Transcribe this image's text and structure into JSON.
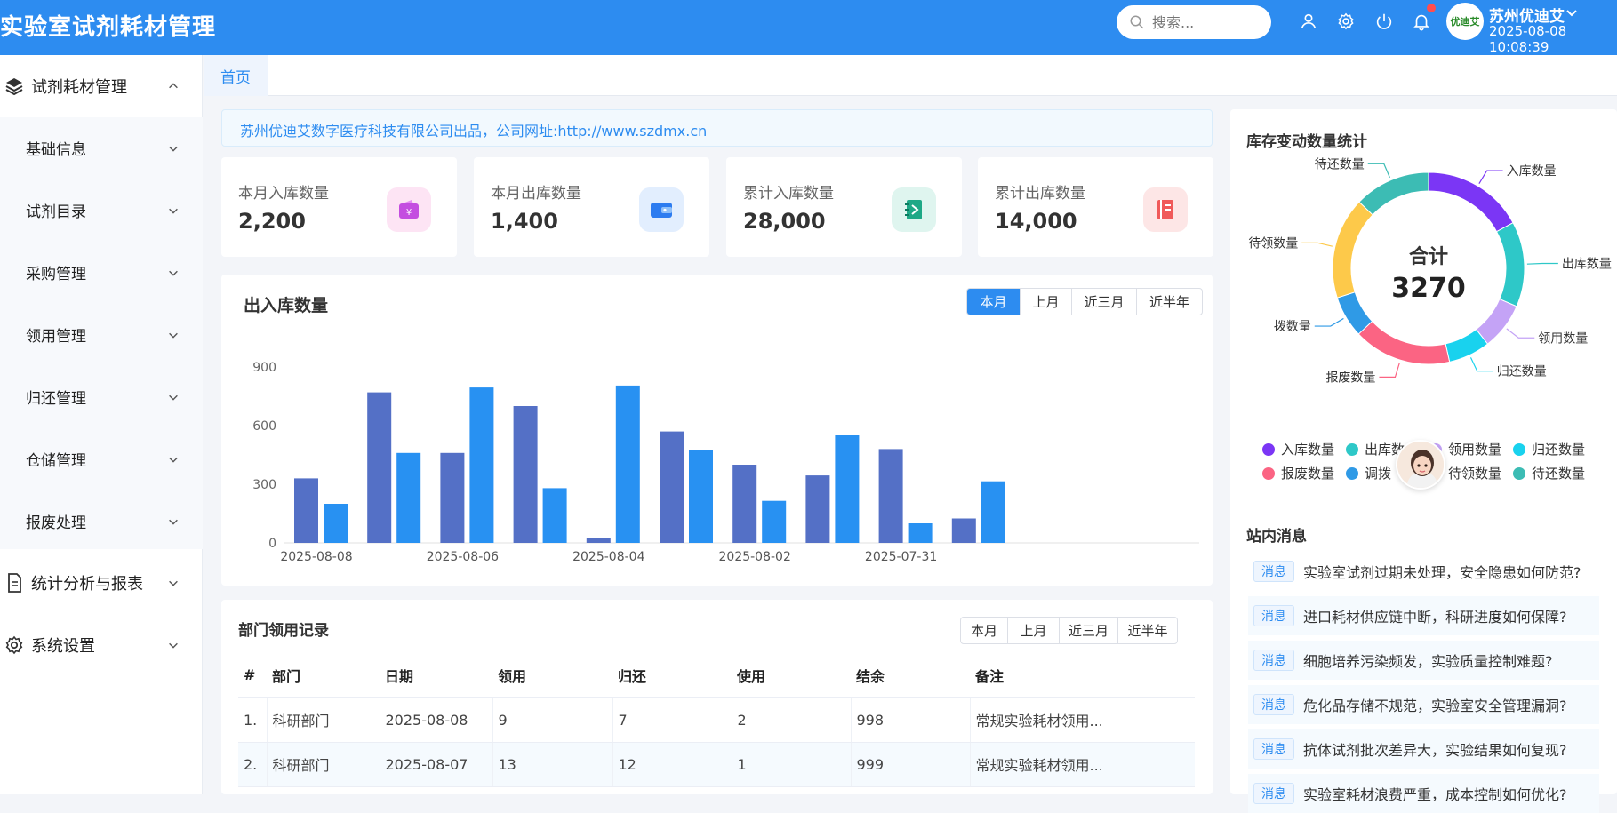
{
  "header": {
    "app_title": "实验室试剂耗材管理",
    "search_placeholder": "搜索...",
    "user_name": "苏州优迪艾",
    "datetime": "2025-08-08 10:08:39",
    "avatar_text": "优迪艾",
    "accent": "#2d8cf0"
  },
  "sidebar": {
    "groups": [
      {
        "label": "试剂耗材管理",
        "icon": "layers-icon",
        "expanded": true,
        "children": [
          "基础信息",
          "试剂目录",
          "采购管理",
          "领用管理",
          "归还管理",
          "仓储管理",
          "报废处理"
        ]
      },
      {
        "label": "统计分析与报表",
        "icon": "document-icon",
        "expanded": false
      },
      {
        "label": "系统设置",
        "icon": "settings-icon",
        "expanded": false
      }
    ]
  },
  "tabs": [
    "首页"
  ],
  "notice": "苏州优迪艾数字医疗科技有限公司出品，公司网址:http://www.szdmx.cn",
  "stats": [
    {
      "label": "本月入库数量",
      "value": "2,200",
      "icon": "wallet-icon",
      "bg": "#fde4f4",
      "color": "#c44de0"
    },
    {
      "label": "本月出库数量",
      "value": "1,400",
      "icon": "card-icon",
      "bg": "#e2eefe",
      "color": "#2d7cf0"
    },
    {
      "label": "累计入库数量",
      "value": "28,000",
      "icon": "notebook-icon",
      "bg": "#dff5ef",
      "color": "#1ea886"
    },
    {
      "label": "累计出库数量",
      "value": "14,000",
      "icon": "book-icon",
      "bg": "#fde6e6",
      "color": "#f05a5a"
    }
  ],
  "range_options": [
    "本月",
    "上月",
    "近三月",
    "近半年"
  ],
  "inout": {
    "title": "出入库数量",
    "active_range": "本月"
  },
  "chart_data": {
    "type": "bar",
    "x_tick_labels": [
      "2025-08-08",
      "2025-08-06",
      "2025-08-04",
      "2025-08-02",
      "2025-07-31"
    ],
    "ylim": [
      0,
      900
    ],
    "yticks": [
      0,
      300,
      600,
      900
    ],
    "grid": false,
    "series": [
      {
        "color": "#5470c6",
        "values": [
          330,
          770,
          460,
          700,
          25,
          570,
          400,
          345,
          480,
          125
        ]
      },
      {
        "color": "#2891f2",
        "values": [
          200,
          460,
          795,
          280,
          805,
          475,
          215,
          550,
          100,
          315
        ]
      }
    ]
  },
  "dept_table": {
    "title": "部门领用记录",
    "active_range": null,
    "columns": [
      "#",
      "部门",
      "日期",
      "领用",
      "归还",
      "使用",
      "结余",
      "备注"
    ],
    "rows": [
      [
        "1.",
        "科研部门",
        "2025-08-08",
        "9",
        "7",
        "2",
        "998",
        "常规实验耗材领用..."
      ],
      [
        "2.",
        "科研部门",
        "2025-08-07",
        "13",
        "12",
        "1",
        "999",
        "常规实验耗材领用..."
      ]
    ]
  },
  "donut": {
    "title": "库存变动数量统计",
    "center_label": "合计",
    "center_value": "3270",
    "segments": [
      {
        "name": "入库数量",
        "label": "入库数量",
        "value": 560,
        "color": "#7b36f5"
      },
      {
        "name": "出库数量",
        "label": "出库数量",
        "value": 470,
        "color": "#2ec8c8"
      },
      {
        "name": "领用数量",
        "label": "领用数量",
        "value": 260,
        "color": "#c4a3f6"
      },
      {
        "name": "归还数量",
        "label": "归还数量",
        "value": 230,
        "color": "#19d2ee"
      },
      {
        "name": "报废数量",
        "label": "报废数量",
        "value": 540,
        "color": "#fb6483"
      },
      {
        "name": "调拨数量",
        "label": "拨数量",
        "value": 230,
        "color": "#2f9ae6"
      },
      {
        "name": "待领数量",
        "label": "待领数量",
        "value": 560,
        "color": "#fdc94a"
      },
      {
        "name": "待还数量",
        "label": "待还数量",
        "value": 420,
        "color": "#3cbcb4"
      }
    ],
    "legend_visible": [
      "入库数量",
      "出库数",
      "领用数量",
      "归还数量",
      "报废数量",
      "调拨",
      "待领数量",
      "待还数量"
    ]
  },
  "messages": {
    "title": "站内消息",
    "tag": "消息",
    "items": [
      "实验室试剂过期未处理，安全隐患如何防范?",
      "进口耗材供应链中断，科研进度如何保障?",
      "细胞培养污染频发，实验质量控制难题?",
      "危化品存储不规范，实验室安全管理漏洞?",
      "抗体试剂批次差异大，实验结果如何复现?",
      "实验室耗材浪费严重，成本控制如何优化?"
    ]
  }
}
